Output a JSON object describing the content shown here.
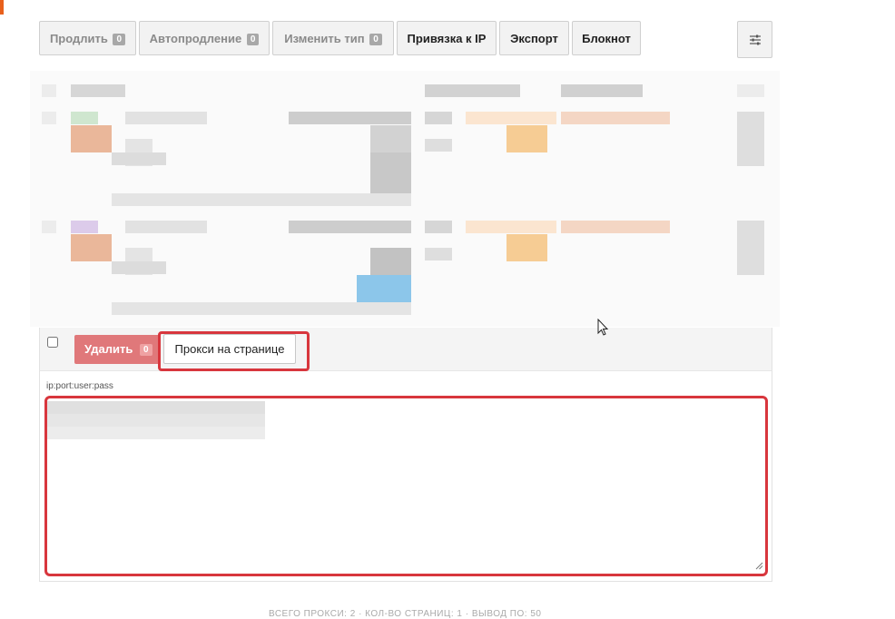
{
  "toolbar": {
    "renew": {
      "label": "Продлить",
      "count": "0"
    },
    "autorenew": {
      "label": "Автопродление",
      "count": "0"
    },
    "change_type": {
      "label": "Изменить тип",
      "count": "0"
    },
    "ip_binding": {
      "label": "Привязка к IP"
    },
    "export": {
      "label": "Экспорт"
    },
    "notepad": {
      "label": "Блокнот"
    },
    "settings_icon": "sliders-icon"
  },
  "actions": {
    "delete": {
      "label": "Удалить",
      "count": "0"
    },
    "proxies_on_page": {
      "label": "Прокси на странице"
    }
  },
  "proxy_field": {
    "label": "ip:port:user:pass"
  },
  "footer": {
    "summary": "ВСЕГО ПРОКСИ: 2 · КОЛ-ВО СТРАНИЦ: 1 · ВЫВОД ПО: 50"
  },
  "colors": {
    "highlight": "#d8363d",
    "delete_button": "#e0787a",
    "accent": "#e8601c"
  }
}
